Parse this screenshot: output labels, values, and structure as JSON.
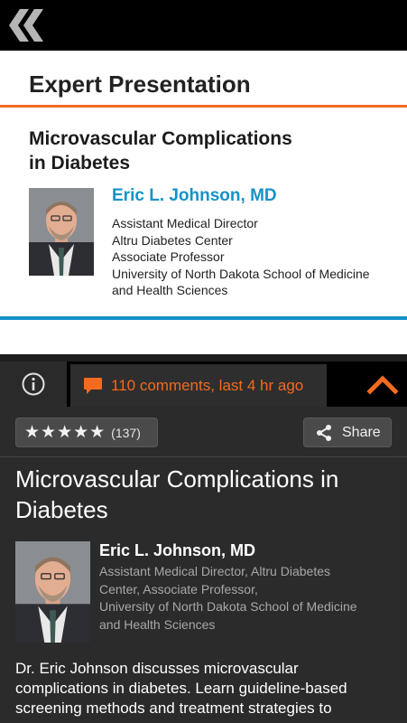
{
  "slide": {
    "header": "Expert Presentation",
    "title_line1": "Microvascular Complications",
    "title_line2": "in Diabetes",
    "speaker": "Eric L. Johnson, MD",
    "details": [
      "Assistant Medical Director",
      "Altru Diabetes Center",
      "Associate Professor",
      "University of North Dakota School of Medicine",
      "and Health Sciences"
    ]
  },
  "tabs": {
    "comments_label": "110 comments, last 4 hr ago"
  },
  "actions": {
    "stars": "★★★★★",
    "rating_count": "(137)",
    "share_label": "Share"
  },
  "info": {
    "title_line1": "Microvascular Complications in",
    "title_line2": "Diabetes",
    "speaker": "Eric L. Johnson, MD",
    "details": [
      "Assistant Medical Director, Altru Diabetes",
      "Center, Associate Professor,",
      "University of North Dakota School of Medicine",
      "and Health Sciences"
    ],
    "description_lines": [
      "Dr. Eric Johnson discusses microvascular",
      "complications in diabetes. Learn guideline-based",
      "screening methods and treatment strategies to"
    ]
  },
  "colors": {
    "orange_accent": "#f26b21",
    "blue_accent": "#1592c8"
  },
  "icons": {
    "back": "double-chevron-left-icon",
    "info": "info-circle-icon",
    "comment": "speech-bubble-icon",
    "collapse": "chevron-up-icon",
    "share": "share-icon"
  }
}
